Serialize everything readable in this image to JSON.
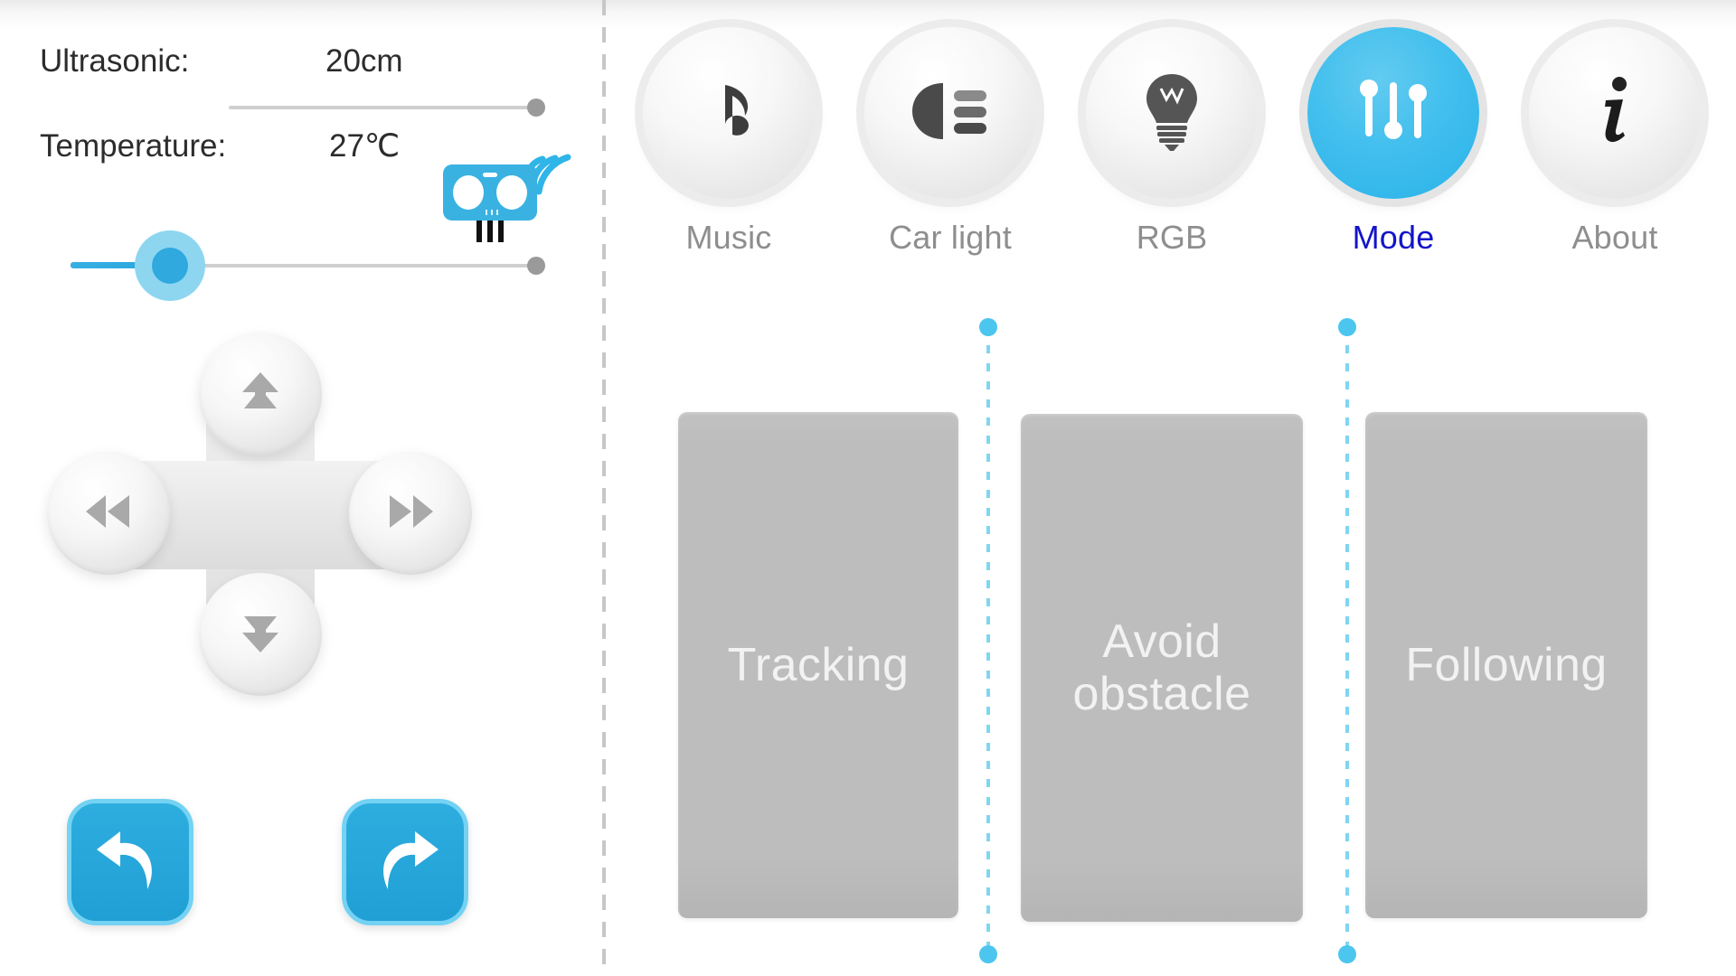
{
  "theme": {
    "accent_blue": "#2fa9de",
    "accent_light_blue": "#4cc6ee",
    "mode_active_label": "#1414c8",
    "card_gray": "#bdbdbd",
    "text_gray": "#8e8e8e",
    "readout_text": "#2c2c2c"
  },
  "sensors": {
    "ultrasonic": {
      "label": "Ultrasonic:",
      "value": "20cm"
    },
    "temperature": {
      "label": "Temperature:",
      "value": "27℃"
    }
  },
  "sliders": [
    {
      "name": "ultrasonic-slider",
      "fill_percent": 0,
      "knob_position_percent": 100
    },
    {
      "name": "temperature-slider",
      "fill_percent": 22,
      "knob_position_percent": 22
    }
  ],
  "dpad": {
    "up": {
      "icon": "double-arrow-up-icon"
    },
    "down": {
      "icon": "double-arrow-down-icon"
    },
    "left": {
      "icon": "double-arrow-left-icon"
    },
    "right": {
      "icon": "double-arrow-right-icon"
    }
  },
  "turn_buttons": [
    {
      "name": "turn-left-button",
      "icon": "curved-arrow-left-icon"
    },
    {
      "name": "turn-right-button",
      "icon": "curved-arrow-right-icon"
    }
  ],
  "topnav": {
    "items": [
      {
        "label": "Music",
        "icon": "music-note-icon",
        "active": false
      },
      {
        "label": "Car light",
        "icon": "headlight-icon",
        "active": false
      },
      {
        "label": "RGB",
        "icon": "lightbulb-icon",
        "active": false
      },
      {
        "label": "Mode",
        "icon": "sliders-icon",
        "active": true
      },
      {
        "label": "About",
        "icon": "info-icon",
        "active": false
      }
    ]
  },
  "mode_panel": {
    "cards": [
      {
        "label": "Tracking",
        "selected": false
      },
      {
        "label": "Avoid\nobstacle",
        "selected": false
      },
      {
        "label": "Following",
        "selected": false
      }
    ]
  }
}
